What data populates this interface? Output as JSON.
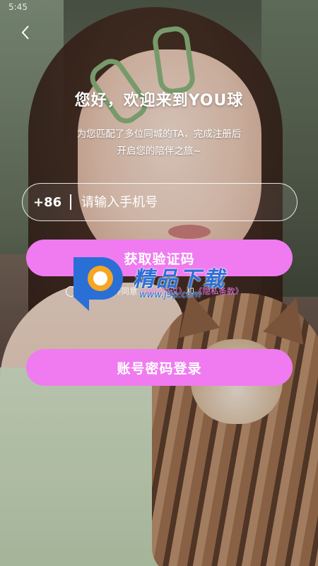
{
  "status_bar": {
    "time": "5:45"
  },
  "header": {
    "back_icon": "chevron-left-icon",
    "title": "您好，欢迎来到YOU球",
    "subtitle_line1": "为您匹配了多位同城的TA，完成注册后",
    "subtitle_line2": "开启您的陪伴之旅~"
  },
  "form": {
    "country_code": "+86",
    "phone_placeholder": "请输入手机号",
    "phone_value": ""
  },
  "actions": {
    "get_code_label": "获取验证码",
    "password_login_label": "账号密码登录"
  },
  "agreement": {
    "prefix": "我已阅读并同意",
    "user_agreement": "《用户协议》",
    "connector": "和",
    "privacy_policy": "《隐私条款》",
    "checked": false
  },
  "watermark": {
    "brand_text": "精品下载",
    "url_text": "www.j9p.com"
  },
  "colors": {
    "accent_pink": "#f07bf0",
    "watermark_blue": "#2a6fd6",
    "watermark_orange": "#f5a623"
  }
}
